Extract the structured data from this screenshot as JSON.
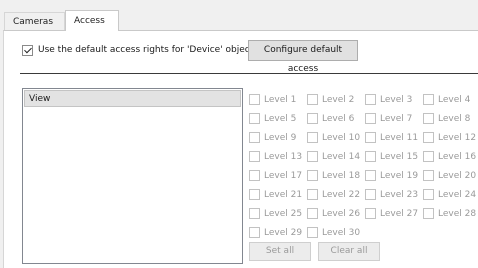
{
  "tabs": [
    {
      "label": "Cameras"
    },
    {
      "label": "Access"
    }
  ],
  "default_access": {
    "checkbox_label": "Use the default access rights for 'Device' objects",
    "checked": true,
    "configure_button": "Configure default access"
  },
  "rights_list": {
    "items": [
      {
        "label": "View",
        "selected": true
      }
    ]
  },
  "levels": [
    {
      "label": "Level 1"
    },
    {
      "label": "Level 2"
    },
    {
      "label": "Level 3"
    },
    {
      "label": "Level 4"
    },
    {
      "label": "Level 5"
    },
    {
      "label": "Level 6"
    },
    {
      "label": "Level 7"
    },
    {
      "label": "Level 8"
    },
    {
      "label": "Level 9"
    },
    {
      "label": "Level 10"
    },
    {
      "label": "Level 11"
    },
    {
      "label": "Level 12"
    },
    {
      "label": "Level 13"
    },
    {
      "label": "Level 14"
    },
    {
      "label": "Level 15"
    },
    {
      "label": "Level 16"
    },
    {
      "label": "Level 17"
    },
    {
      "label": "Level 18"
    },
    {
      "label": "Level 19"
    },
    {
      "label": "Level 20"
    },
    {
      "label": "Level 21"
    },
    {
      "label": "Level 22"
    },
    {
      "label": "Level 23"
    },
    {
      "label": "Level 24"
    },
    {
      "label": "Level 25"
    },
    {
      "label": "Level 26"
    },
    {
      "label": "Level 27"
    },
    {
      "label": "Level 28"
    },
    {
      "label": "Level 29"
    },
    {
      "label": "Level 30"
    }
  ],
  "buttons": {
    "set_all": "Set all",
    "clear_all": "Clear all"
  }
}
